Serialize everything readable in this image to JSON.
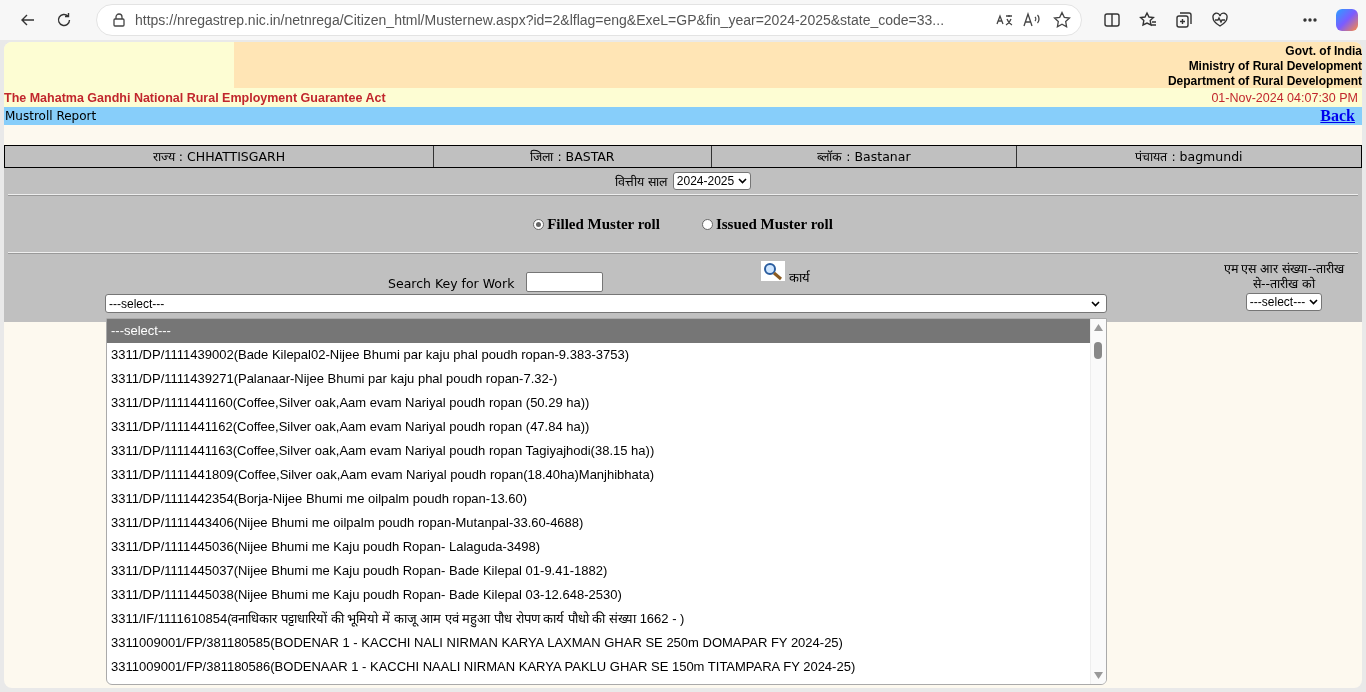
{
  "browser": {
    "url": "https://nregastrep.nic.in/netnrega/Citizen_html/Musternew.aspx?id=2&lflag=eng&ExeL=GP&fin_year=2024-2025&state_code=33..."
  },
  "header": {
    "org_lines": [
      "Govt. of India",
      "Ministry of Rural Development",
      "Department of Rural Development"
    ],
    "act_title": "The Mahatma Gandhi National Rural Employment Guarantee Act",
    "datetime": "01-Nov-2024 04:07:30 PM"
  },
  "report_bar": {
    "title": "Mustroll Report",
    "back_link": "Back"
  },
  "location": [
    "राज्य : CHHATTISGARH",
    "जिला : BASTAR",
    "ब्लॉक : Bastanar",
    "पंचायत : bagmundi"
  ],
  "financial_year": {
    "label": "वित्तीय साल",
    "value": "2024-2025"
  },
  "muster_type": [
    {
      "label": "Filled Muster roll",
      "selected": true
    },
    {
      "label": "Issued Muster roll",
      "selected": false
    }
  ],
  "search": {
    "label": "Search Key for Work"
  },
  "work": {
    "label": "कार्य",
    "value": "---select---",
    "expanded": true,
    "options": [
      {
        "label": "---select---",
        "selected": true
      },
      {
        "label": "3311/DP/1111439002(Bade Kilepal02-Nijee Bhumi par kaju phal poudh ropan-9.383-3753)",
        "selected": false
      },
      {
        "label": "3311/DP/1111439271(Palanaar-Nijee Bhumi par kaju phal poudh ropan-7.32-)",
        "selected": false
      },
      {
        "label": "3311/DP/1111441160(Coffee,Silver oak,Aam evam Nariyal poudh ropan (50.29 ha))",
        "selected": false
      },
      {
        "label": "3311/DP/1111441162(Coffee,Silver oak,Aam evam Nariyal poudh ropan (47.84 ha))",
        "selected": false
      },
      {
        "label": "3311/DP/1111441163(Coffee,Silver oak,Aam evam Nariyal poudh ropan Tagiyajhodi(38.15 ha))",
        "selected": false
      },
      {
        "label": "3311/DP/1111441809(Coffee,Silver oak,Aam evam Nariyal poudh ropan(18.40ha)Manjhibhata)",
        "selected": false
      },
      {
        "label": "3311/DP/1111442354(Borja-Nijee Bhumi me oilpalm poudh ropan-13.60)",
        "selected": false
      },
      {
        "label": "3311/DP/1111443406(Nijee Bhumi me oilpalm poudh ropan-Mutanpal-33.60-4688)",
        "selected": false
      },
      {
        "label": "3311/DP/1111445036(Nijee Bhumi me Kaju poudh Ropan- Lalaguda-3498)",
        "selected": false
      },
      {
        "label": "3311/DP/1111445037(Nijee Bhumi me Kaju poudh Ropan- Bade Kilepal 01-9.41-1882)",
        "selected": false
      },
      {
        "label": "3311/DP/1111445038(Nijee Bhumi me Kaju poudh Ropan- Bade Kilepal 03-12.648-2530)",
        "selected": false
      },
      {
        "label": "3311/IF/1111610854(वनाधिकार पट्टाधारियों की भूमियो में काजू आम एवं महुआ पौध रोपण कार्य पौधो की संख्या 1662 - )",
        "selected": false
      },
      {
        "label": "3311009001/FP/381180585(BODENAR 1 - KACCHI NALI NIRMAN KARYA LAXMAN GHAR SE 250m DOMAPAR FY 2024-25)",
        "selected": false
      },
      {
        "label": "3311009001/FP/381180586(BODENAAR 1 - KACCHI NAALI NIRMAN KARYA PAKLU GHAR SE 150m TITAMPARA FY 2024-25)",
        "selected": false
      }
    ]
  },
  "msr": {
    "label_lines": [
      "एम एस आर संख्या--तारीख",
      "से--तारीख को"
    ],
    "value": "---select---"
  }
}
